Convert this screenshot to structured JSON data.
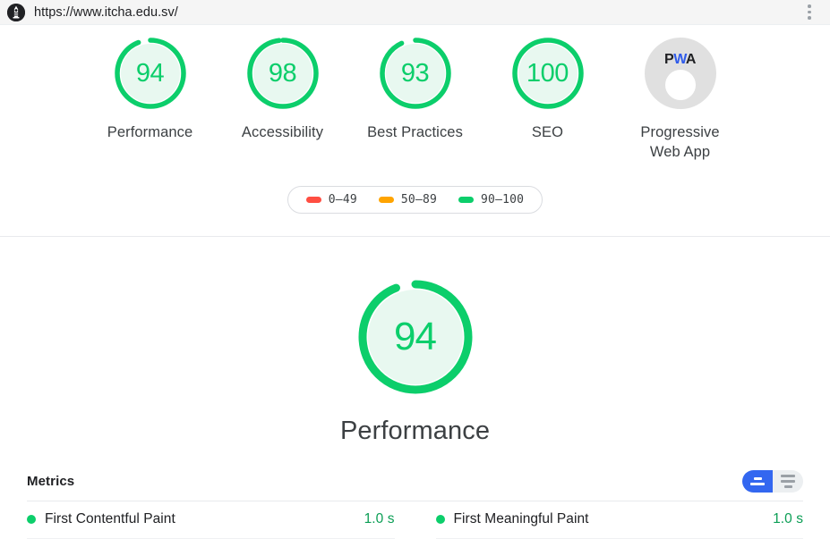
{
  "header": {
    "logo_icon": "lighthouse-icon",
    "url": "https://www.itcha.edu.sv/",
    "menu_icon": "kebab-menu-icon"
  },
  "colors": {
    "pass": "#0cce6b",
    "pass_bg": "#e8f8f0",
    "average": "#ffa400",
    "fail": "#ff4e42",
    "gray": "#e0e0e0",
    "blue": "#3367f0",
    "pwa_blue": "#2f5bea"
  },
  "score_gauges": [
    {
      "score": "94",
      "label": "Performance",
      "value": 94,
      "state": "pass"
    },
    {
      "score": "98",
      "label": "Accessibility",
      "value": 98,
      "state": "pass"
    },
    {
      "score": "93",
      "label": "Best Practices",
      "value": 93,
      "state": "pass"
    },
    {
      "score": "100",
      "label": "SEO",
      "value": 100,
      "state": "pass"
    }
  ],
  "pwa": {
    "logo_p": "P",
    "logo_w": "W",
    "logo_a": "A",
    "label_line1": "Progressive",
    "label_line2": "Web App"
  },
  "legend": [
    {
      "range": "0–49",
      "color": "#ff4e42"
    },
    {
      "range": "50–89",
      "color": "#ffa400"
    },
    {
      "range": "90–100",
      "color": "#0cce6b"
    }
  ],
  "category": {
    "score": "94",
    "value": 94,
    "title": "Performance"
  },
  "metrics_section": {
    "title": "Metrics",
    "toggle": {
      "simple_view_label": "simple-view-icon",
      "expanded_view_label": "expanded-view-icon",
      "active": "simple"
    },
    "rows_left": [
      {
        "name": "First Contentful Paint",
        "value": "1.0 s",
        "state": "pass"
      }
    ],
    "rows_right": [
      {
        "name": "First Meaningful Paint",
        "value": "1.0 s",
        "state": "pass"
      }
    ]
  }
}
